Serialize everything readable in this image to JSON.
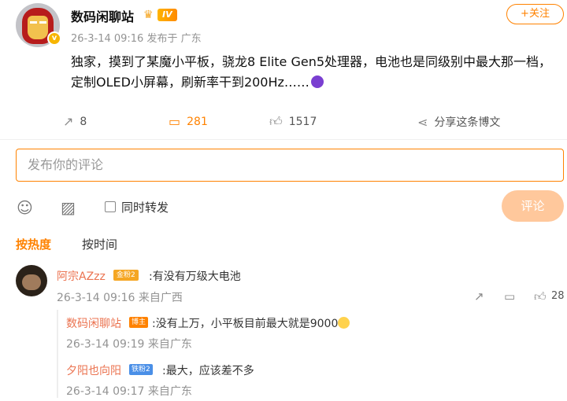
{
  "post": {
    "author": "数码闲聊站",
    "level": "IV",
    "meta": "26-3-14 09:16 发布于 广东",
    "follow_label": "+关注",
    "text": "独家，摸到了某魔小平板，骁龙8 Elite Gen5处理器，电池也是同级别中最大那一档，定制OLED小屏幕，刷新率干到200Hz……",
    "actions": {
      "repost": "8",
      "comments": "281",
      "likes": "1517",
      "share": "分享这条博文"
    }
  },
  "composer": {
    "placeholder": "发布你的评论",
    "repost_label": "同时转发",
    "submit_label": "评论"
  },
  "sort": {
    "hot": "按热度",
    "time": "按时间"
  },
  "comments": [
    {
      "user": "阿宗AZzz",
      "badge": "金粉2",
      "text": ":有没有万级大电池",
      "time": "26-3-14 09:16 来自广西",
      "likes": "28",
      "replies": [
        {
          "user": "数码闲聊站",
          "badge": "博主",
          "text": ":没有上万，小平板目前最大就是9000",
          "time": "26-3-14 09:19 来自广东"
        },
        {
          "user": "夕阳也向阳",
          "badge": "铁粉2",
          "text": ":最大，应该差不多",
          "time": "26-3-14 09:17 来自广东"
        }
      ]
    }
  ]
}
